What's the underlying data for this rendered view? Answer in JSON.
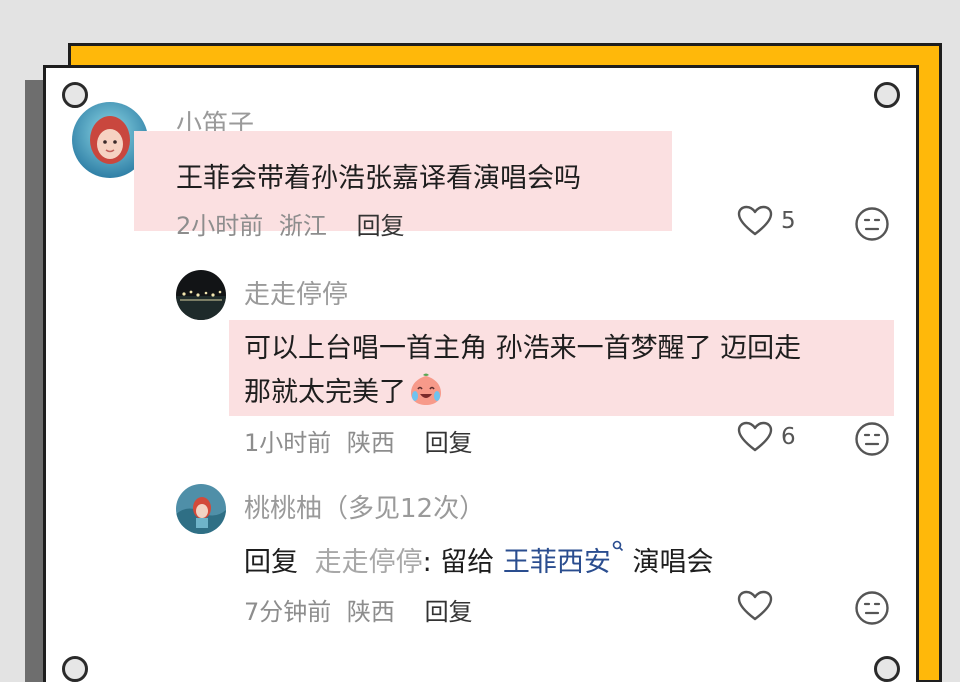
{
  "comments": [
    {
      "username": "小笛子",
      "text": "王菲会带着孙浩张嘉译看演唱会吗",
      "time": "2小时前",
      "location": "浙江",
      "reply_label": "回复",
      "likes": "5"
    },
    {
      "username": "走走停停",
      "text_line1": "可以上台唱一首主角 孙浩来一首梦醒了 迈回走",
      "text_line2": "那就太完美了",
      "emoji": "crying-laughing-peach-emoji",
      "time": "1小时前",
      "location": "陕西",
      "reply_label": "回复",
      "likes": "6"
    },
    {
      "username": "桃桃柚（多见12次）",
      "reply_prefix": "回复",
      "reply_to": "走走停停",
      "text_a": ": 留给 ",
      "search_link": "王菲西安",
      "text_b": " 演唱会",
      "time": "7分钟前",
      "location": "陕西",
      "reply_label": "回复",
      "likes": ""
    }
  ],
  "colors": {
    "highlight": "#fbe0e1",
    "frame_yellow": "#ffb80a",
    "link": "#2a4d8f"
  },
  "icons": [
    "heart-outline-icon",
    "neutral-face-icon",
    "search-superscript-icon"
  ]
}
